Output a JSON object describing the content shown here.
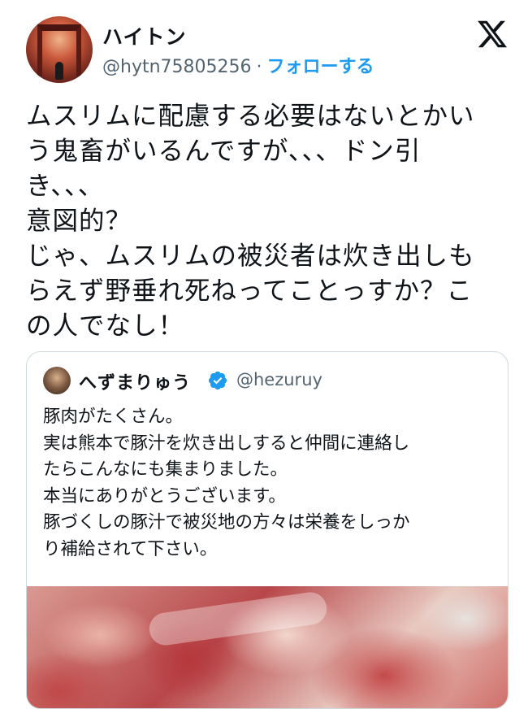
{
  "author": {
    "display_name": "ハイトン",
    "handle": "@hytn75805256",
    "separator": "·",
    "follow_label": "フォローする"
  },
  "brand": {
    "logo_icon": "x-logo-icon"
  },
  "tweet": {
    "text": "ムスリムに配慮する必要はないとかい\nう鬼畜がいるんですが、、、ドン引\nき、、、\n意図的？\nじゃ、ムスリムの被災者は炊き出しも\nらえず野垂れ死ねってことっすか？こ\nの人でなし！"
  },
  "quoted_tweet": {
    "display_name": "へずまりゅう",
    "verified_icon": "verified-badge-icon",
    "handle": "@hezuruy",
    "text": "豚肉がたくさん。\n実は熊本で豚汁を炊き出しすると仲間に連絡し\nたらこんなにも集まりました。\n本当にありがとうございます。\n豚づくしの豚汁で被災地の方々は栄養をしっか\nり補給されて下さい。"
  },
  "colors": {
    "link_blue": "#1d9bf0",
    "secondary_text": "#536471",
    "border": "#cfd9de"
  }
}
